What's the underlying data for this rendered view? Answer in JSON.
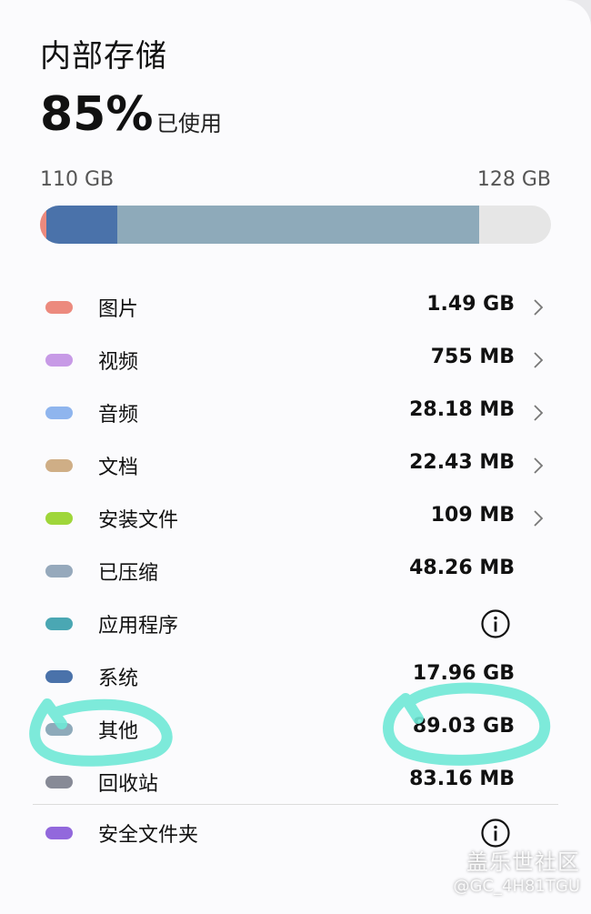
{
  "header": {
    "title": "内部存储",
    "percent": "85%",
    "used_label": "已使用",
    "used_capacity": "110 GB",
    "total_capacity": "128 GB"
  },
  "usage_bar": {
    "used_fraction": 0.859,
    "segments": [
      {
        "name": "图片",
        "fraction": 0.012,
        "color": "#ec8a7e"
      },
      {
        "name": "系统",
        "fraction": 0.14,
        "color": "#4a72aa"
      },
      {
        "name": "其他",
        "fraction": 0.707,
        "color": "#8eaaba"
      }
    ],
    "empty_color": "#e6e6e6"
  },
  "categories": [
    {
      "label": "图片",
      "value": "1.49 GB",
      "color": "#ec8a7e",
      "action": "chevron-right-icon"
    },
    {
      "label": "视频",
      "value": "755 MB",
      "color": "#c79ae6",
      "action": "chevron-right-icon"
    },
    {
      "label": "音频",
      "value": "28.18 MB",
      "color": "#8fb5ee",
      "action": "chevron-right-icon"
    },
    {
      "label": "文档",
      "value": "22.43 MB",
      "color": "#cfae86",
      "action": "chevron-right-icon"
    },
    {
      "label": "安装文件",
      "value": "109 MB",
      "color": "#9fd63a",
      "action": "chevron-right-icon"
    },
    {
      "label": "已压缩",
      "value": "48.26 MB",
      "color": "#96a9bc",
      "action": ""
    },
    {
      "label": "应用程序",
      "value": "",
      "color": "#4aa7b3",
      "action": "info-icon"
    },
    {
      "label": "系统",
      "value": "17.96 GB",
      "color": "#4a72aa",
      "action": ""
    },
    {
      "label": "其他",
      "value": "89.03 GB",
      "color": "#8eaaba",
      "action": ""
    },
    {
      "label": "回收站",
      "value": "83.16 MB",
      "color": "#878a96",
      "action": ""
    }
  ],
  "secure_folder": {
    "label": "安全文件夹",
    "color": "#9268dc",
    "action": "info-icon"
  },
  "watermark": {
    "line1": "盖乐世社区",
    "line2": "@GC_4H81TGU"
  },
  "annotation_color": "#6fe8d6"
}
